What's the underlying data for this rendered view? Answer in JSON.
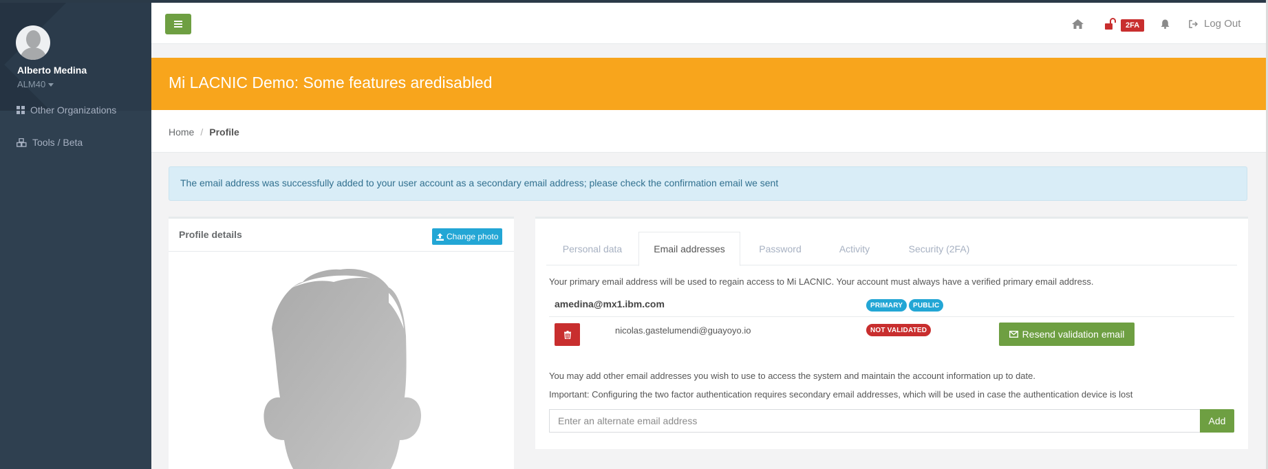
{
  "sidebar": {
    "user_name": "Alberto Medina",
    "user_handle": "ALM40",
    "items": [
      {
        "label": "Other Organizations",
        "icon": "grid-icon"
      },
      {
        "label": "Tools / Beta",
        "icon": "cubes-icon"
      }
    ]
  },
  "topbar": {
    "twofa_badge": "2FA",
    "logout_label": "Log Out"
  },
  "banner": {
    "text": "Mi LACNIC Demo: Some features aredisabled"
  },
  "breadcrumb": {
    "home": "Home",
    "separator": "/",
    "current": "Profile"
  },
  "alert": {
    "text": "The email address was successfully added to your user account as a secondary email address; please check the confirmation email we sent"
  },
  "profile_card": {
    "title": "Profile details",
    "change_photo_label": "Change photo"
  },
  "tabs": [
    {
      "label": "Personal data",
      "active": false
    },
    {
      "label": "Email addresses",
      "active": true
    },
    {
      "label": "Password",
      "active": false
    },
    {
      "label": "Activity",
      "active": false
    },
    {
      "label": "Security (2FA)",
      "active": false
    }
  ],
  "emails": {
    "intro": "Your primary email address will be used to regain access to Mi LACNIC. Your account must always have a verified primary email address.",
    "primary": {
      "address": "amedina@mx1.ibm.com",
      "badges": [
        "PRIMARY",
        "PUBLIC"
      ]
    },
    "secondary": {
      "address": "nicolas.gastelumendi@guayoyo.io",
      "badge": "NOT VALIDATED",
      "resend_label": "Resend validation email"
    },
    "info1": "You may add other email addresses you wish to use to access the system and maintain the account information up to date.",
    "info2": "Important: Configuring the two factor authentication requires secondary email addresses, which will be used in case the authentication device is lost",
    "input_placeholder": "Enter an alternate email address",
    "add_label": "Add"
  },
  "colors": {
    "sidebar": "#2f4050",
    "accent_green": "#6e9f42",
    "banner_orange": "#f8a51c",
    "badge_blue": "#23a6d5",
    "danger_red": "#c82e2e"
  }
}
